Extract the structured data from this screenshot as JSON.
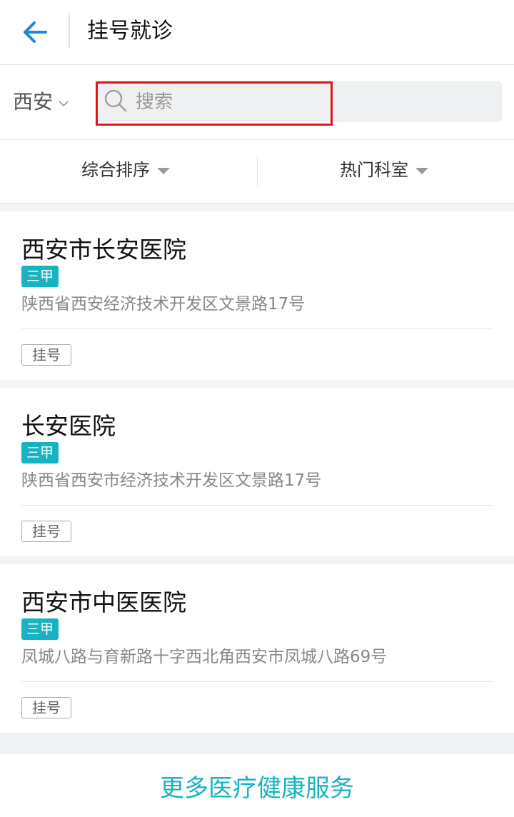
{
  "header": {
    "title": "挂号就诊"
  },
  "search": {
    "city": "西安",
    "placeholder": "搜索",
    "value": ""
  },
  "filters": {
    "sort_label": "综合排序",
    "department_label": "热门科室"
  },
  "hospitals": [
    {
      "name": "西安市长安医院",
      "level": "三甲",
      "address": "陕西省西安经济技术开发区文景路17号",
      "action": "挂号"
    },
    {
      "name": "长安医院",
      "level": "三甲",
      "address": "陕西省西安市经济技术开发区文景路17号",
      "action": "挂号"
    },
    {
      "name": "西安市中医医院",
      "level": "三甲",
      "address": "凤城八路与育新路十字西北角西安市凤城八路69号",
      "action": "挂号"
    }
  ],
  "footer": {
    "more_link": "更多医疗健康服务"
  },
  "colors": {
    "accent": "#1a8ad6",
    "teal": "#17b3c0",
    "highlight": "#e01616"
  },
  "icons": {
    "back": "arrow-left-icon",
    "city_dropdown": "chevron-down-icon",
    "search": "search-icon",
    "dropdown": "caret-down-icon"
  }
}
